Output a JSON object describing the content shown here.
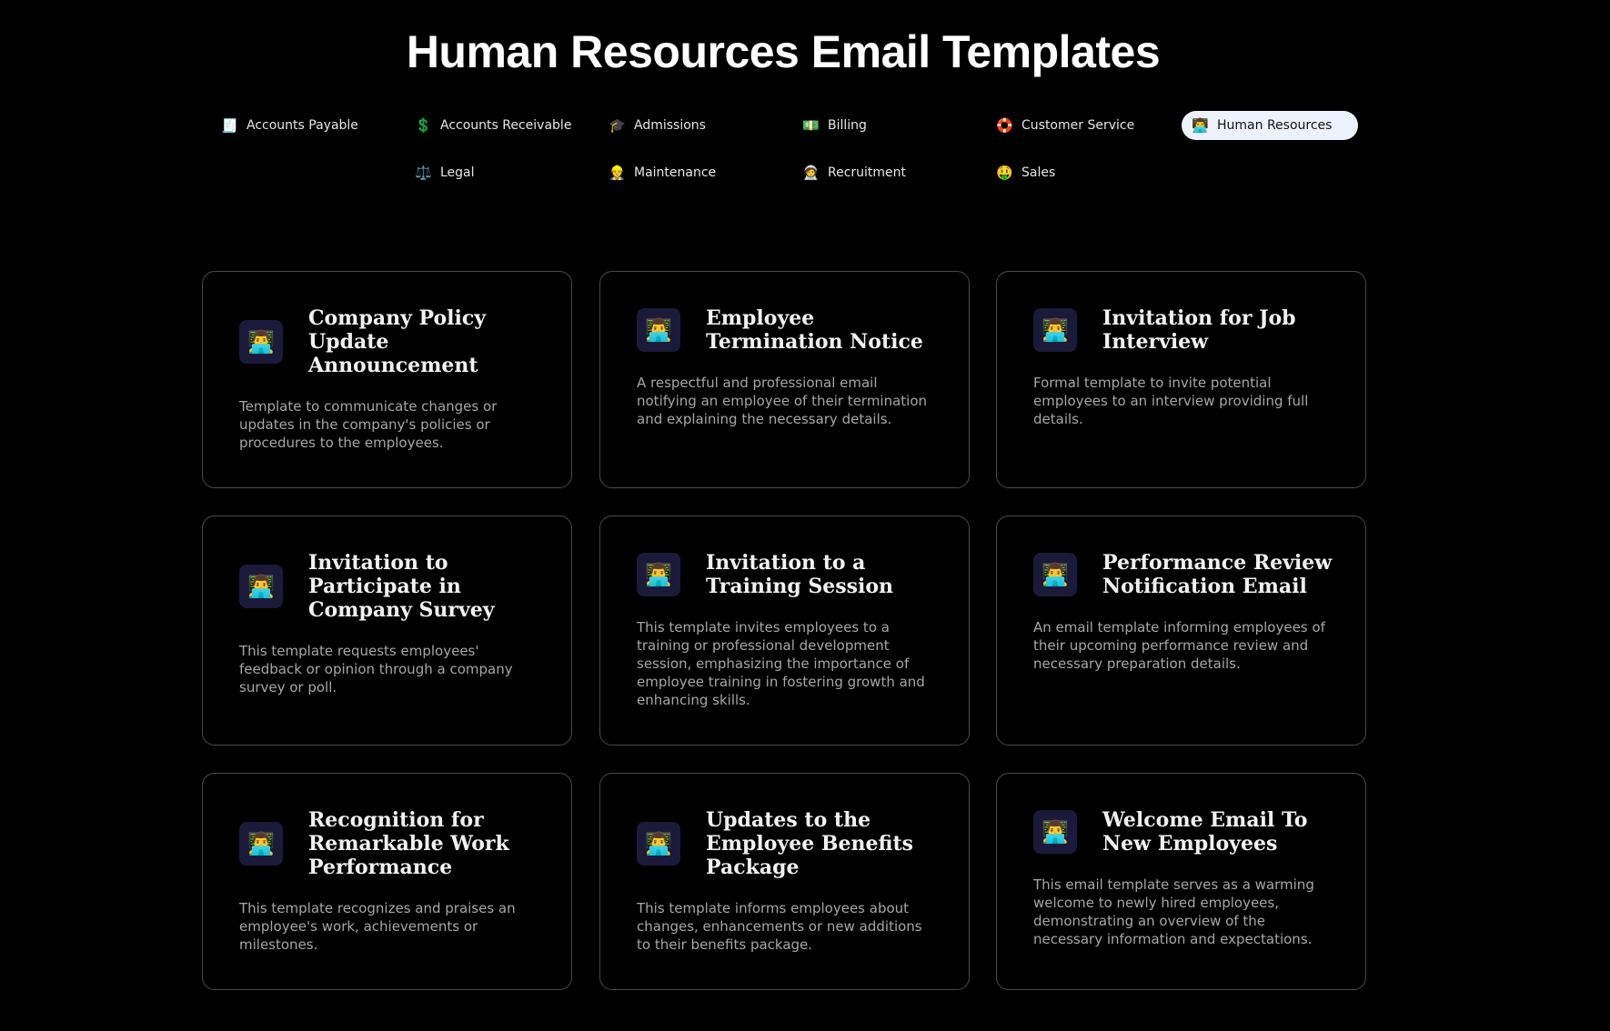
{
  "page": {
    "title": "Human Resources Email Templates"
  },
  "categories": [
    {
      "label": "Accounts Payable",
      "icon": "🧾",
      "active": false
    },
    {
      "label": "Accounts Receivable",
      "icon": "💲",
      "active": false
    },
    {
      "label": "Admissions",
      "icon": "🎓",
      "active": false
    },
    {
      "label": "Billing",
      "icon": "💵",
      "active": false
    },
    {
      "label": "Customer Service",
      "icon": "🛟",
      "active": false
    },
    {
      "label": "Human Resources",
      "icon": "👨‍💻",
      "active": true
    },
    {
      "label": "Legal",
      "icon": "⚖️",
      "active": false
    },
    {
      "label": "Maintenance",
      "icon": "👷",
      "active": false
    },
    {
      "label": "Recruitment",
      "icon": "🧑‍🚀",
      "active": false
    },
    {
      "label": "Sales",
      "icon": "🤑",
      "active": false
    }
  ],
  "cards": [
    {
      "icon": "👨‍💻",
      "title": "Company Policy Update Announcement",
      "description": "Template to communicate changes or updates in the company's policies or procedures to the employees."
    },
    {
      "icon": "👨‍💻",
      "title": "Employee Termination Notice",
      "description": "A respectful and professional email notifying an employee of their termination and explaining the necessary details."
    },
    {
      "icon": "👨‍💻",
      "title": "Invitation for Job Interview",
      "description": "Formal template to invite potential employees to an interview providing full details."
    },
    {
      "icon": "👨‍💻",
      "title": "Invitation to Participate in Company Survey",
      "description": "This template requests employees' feedback or opinion through a company survey or poll."
    },
    {
      "icon": "👨‍💻",
      "title": "Invitation to a Training Session",
      "description": "This template invites employees to a training or professional development session, emphasizing the importance of employee training in fostering growth and enhancing skills."
    },
    {
      "icon": "👨‍💻",
      "title": "Performance Review Notification Email",
      "description": "An email template informing employees of their upcoming performance review and necessary preparation details."
    },
    {
      "icon": "👨‍💻",
      "title": "Recognition for Remarkable Work Performance",
      "description": "This template recognizes and praises an employee's work, achievements or milestones."
    },
    {
      "icon": "👨‍💻",
      "title": "Updates to the Employee Benefits Package",
      "description": "This template informs employees about changes, enhancements or new additions to their benefits package."
    },
    {
      "icon": "👨‍💻",
      "title": "Welcome Email To New Employees",
      "description": "This email template serves as a warming welcome to newly hired employees, demonstrating an overview of the necessary information and expectations."
    }
  ],
  "colors": {
    "background": "#000000",
    "card_border": "#4a4a4a",
    "active_pill": "#eef2ff",
    "icon_box": "#1c1a3a",
    "description_text": "#a6a6a6"
  }
}
